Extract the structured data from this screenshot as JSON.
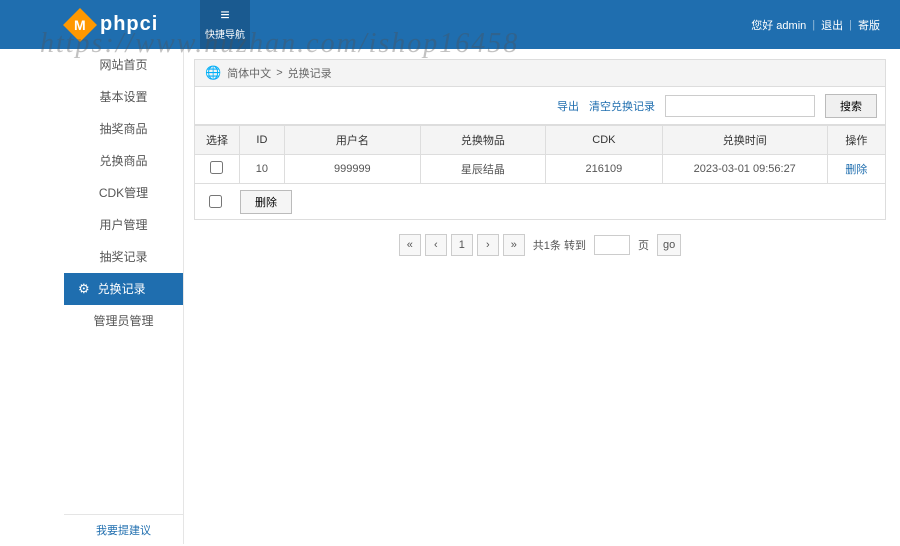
{
  "header": {
    "logo_letter": "M",
    "logo_text": "phpci",
    "quick_nav": "快捷导航",
    "greeting": "您好 admin",
    "logout": "退出",
    "site": "寄版"
  },
  "watermark": "https://www.huzhan.com/ishop16458",
  "sidebar": {
    "items": [
      {
        "label": "网站首页"
      },
      {
        "label": "基本设置"
      },
      {
        "label": "抽奖商品"
      },
      {
        "label": "兑换商品"
      },
      {
        "label": "CDK管理"
      },
      {
        "label": "用户管理"
      },
      {
        "label": "抽奖记录"
      },
      {
        "label": "兑换记录",
        "active": true
      },
      {
        "label": "管理员管理"
      }
    ],
    "footer": "我要提建议"
  },
  "breadcrumb": {
    "root": "简体中文",
    "current": "兑换记录"
  },
  "toolbar": {
    "export": "导出",
    "clear": "清空兑换记录",
    "search_placeholder": "",
    "search_btn": "搜索"
  },
  "table": {
    "headers": {
      "select": "选择",
      "id": "ID",
      "user": "用户名",
      "item": "兑换物品",
      "cdk": "CDK",
      "time": "兑换时间",
      "op": "操作"
    },
    "rows": [
      {
        "id": "10",
        "user": "999999",
        "item": "星辰结晶",
        "cdk": "216109",
        "time": "2023-03-01 09:56:27",
        "op": "删除"
      }
    ]
  },
  "bulk": {
    "delete": "删除"
  },
  "pager": {
    "first": "«",
    "prev": "‹",
    "page": "1",
    "next": "›",
    "last": "»",
    "total_prefix": "共1条 转到",
    "page_suffix": "页",
    "go": "go"
  }
}
